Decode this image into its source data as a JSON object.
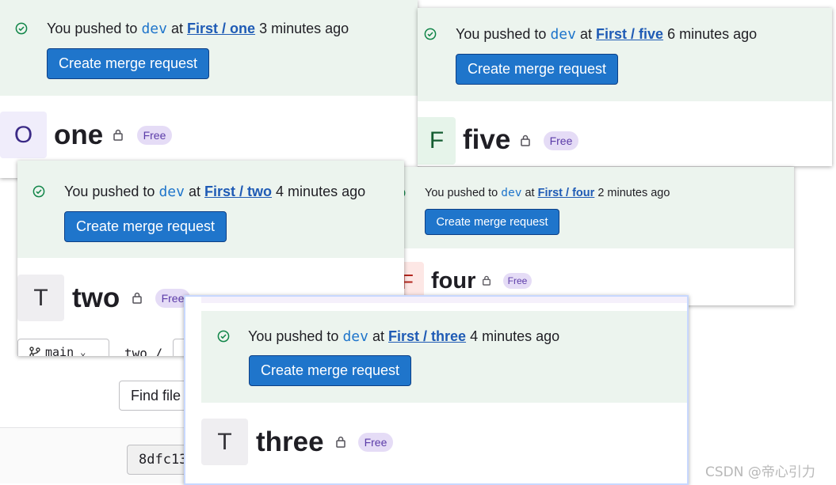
{
  "common": {
    "push_prefix": "You pushed to",
    "branch": "dev",
    "at_word": "at",
    "button_label": "Create merge request",
    "badge_label": "Free"
  },
  "panels": {
    "one": {
      "link": "First / one",
      "time": "3 minutes ago",
      "avatar_letter": "O",
      "title": "one"
    },
    "five": {
      "link": "First / five",
      "time": "6 minutes ago",
      "avatar_letter": "F",
      "title": "five"
    },
    "two": {
      "link": "First / two",
      "time": "4 minutes ago",
      "avatar_letter": "T",
      "title": "two"
    },
    "four": {
      "link": "First / four",
      "time": "2 minutes ago",
      "avatar_letter": "F",
      "title": "four"
    },
    "three": {
      "link": "First / three",
      "time": "4 minutes ago",
      "avatar_letter": "T",
      "title": "three"
    }
  },
  "background": {
    "branch_select": "main",
    "path_crumb": "two /",
    "find_file_label": "Find file",
    "commit_sha": "8dfc13"
  },
  "watermark": "CSDN @帝心引力",
  "colors": {
    "banner": "#ecf4ee",
    "button": "#1f75cb",
    "link": "#1f5bb5",
    "badge_bg": "#e5dcf6",
    "badge_text": "#5b3ba8"
  }
}
